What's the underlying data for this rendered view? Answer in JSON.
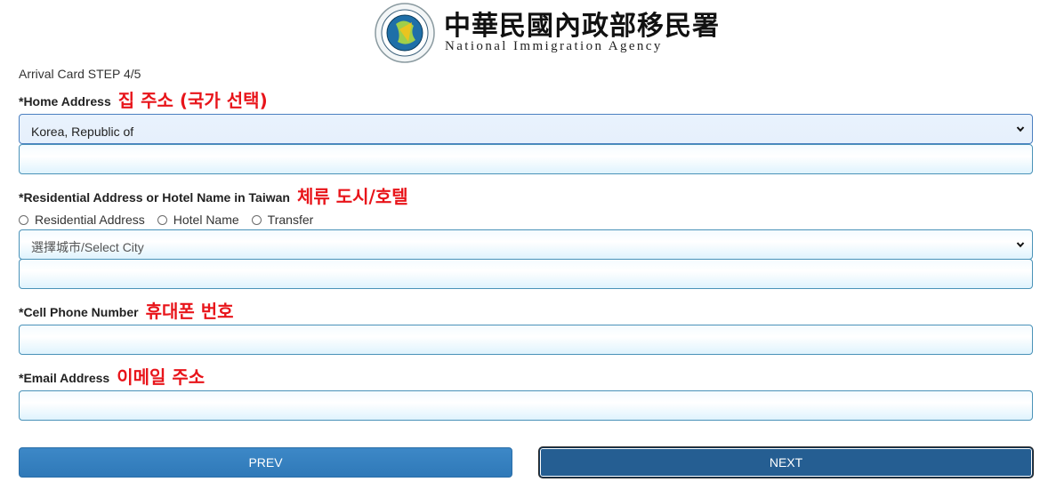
{
  "header": {
    "agency_zh": "中華民國內政部移民署",
    "agency_en": "National Immigration Agency"
  },
  "step_label": "Arrival Card STEP 4/5",
  "home_address": {
    "label": "*Home Address",
    "annotation": "집 주소 (국가 선택)",
    "country_selected": "Korea, Republic of",
    "address_value": ""
  },
  "residential": {
    "label": "*Residential Address or Hotel Name in Taiwan",
    "annotation": "체류 도시/호텔",
    "options": [
      "Residential Address",
      "Hotel Name",
      "Transfer"
    ],
    "city_placeholder": "選擇城市/Select City",
    "address_value": ""
  },
  "phone": {
    "label": "*Cell Phone Number",
    "annotation": "휴대폰 번호",
    "value": ""
  },
  "email": {
    "label": "*Email Address",
    "annotation": "이메일 주소",
    "value": ""
  },
  "buttons": {
    "prev": "PREV",
    "next": "NEXT"
  },
  "colors": {
    "annotation_red": "#e8141a",
    "field_border": "#4a92b8",
    "prev_button": "#3181c0",
    "next_button": "#255e92"
  },
  "icons": [
    "agency-emblem-icon",
    "chevron-down-icon"
  ]
}
